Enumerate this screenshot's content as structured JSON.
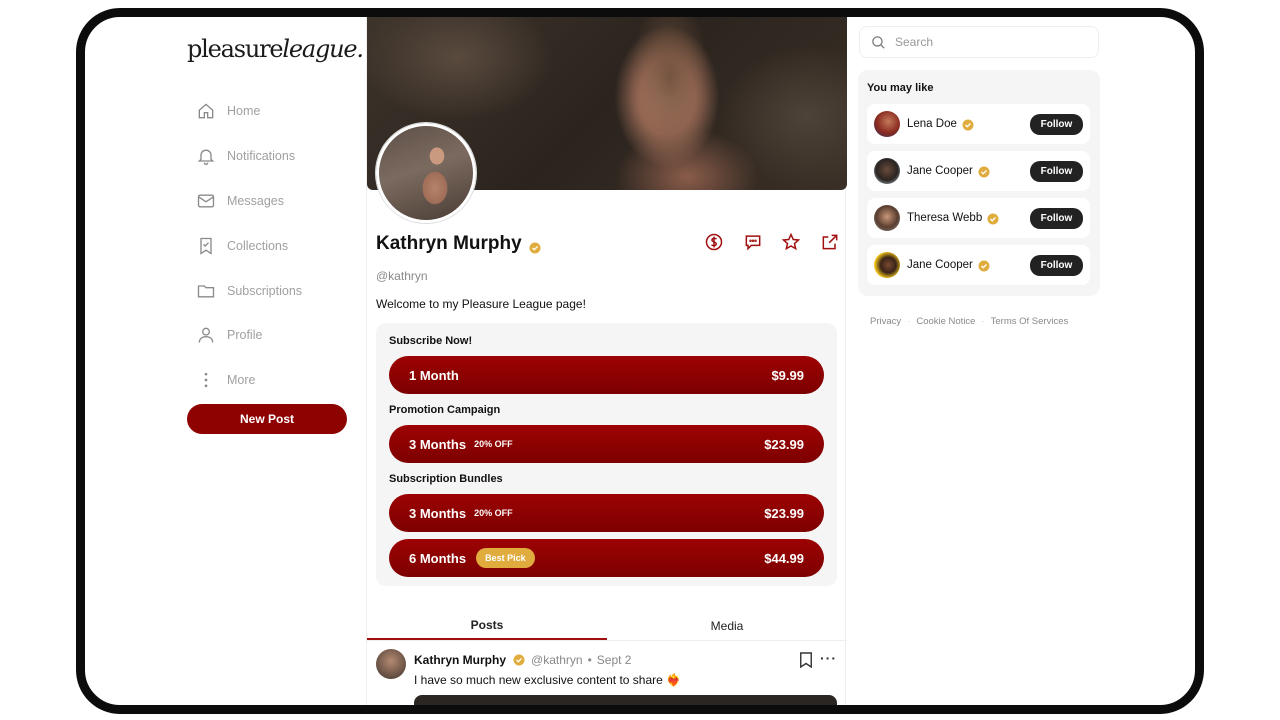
{
  "app": {
    "logo_regular": "pleasure",
    "logo_italic": "league."
  },
  "nav": {
    "items": [
      {
        "label": "Home",
        "icon": "home-icon"
      },
      {
        "label": "Notifications",
        "icon": "bell-icon"
      },
      {
        "label": "Messages",
        "icon": "mail-icon"
      },
      {
        "label": "Collections",
        "icon": "bookmark-check-icon"
      },
      {
        "label": "Subscriptions",
        "icon": "folder-icon"
      },
      {
        "label": "Profile",
        "icon": "user-icon"
      },
      {
        "label": "More",
        "icon": "more-vertical-icon"
      }
    ],
    "new_post_label": "New Post"
  },
  "profile": {
    "name": "Kathryn Murphy",
    "handle": "@kathryn",
    "bio": "Welcome to my Pleasure League page!"
  },
  "subscribe": {
    "now_title": "Subscribe Now!",
    "now": {
      "duration": "1 Month",
      "price": "$9.99"
    },
    "promo_title": "Promotion Campaign",
    "promo": {
      "duration": "3 Months",
      "discount": "20% OFF",
      "price": "$23.99"
    },
    "bundles_title": "Subscription Bundles",
    "bundles": [
      {
        "duration": "3 Months",
        "discount": "20% OFF",
        "price": "$23.99"
      },
      {
        "duration": "6 Months",
        "badge": "Best Pick",
        "price": "$44.99"
      }
    ]
  },
  "tabs": [
    {
      "label": "Posts",
      "active": true
    },
    {
      "label": "Media",
      "active": false
    }
  ],
  "post": {
    "author": "Kathryn Murphy",
    "handle": "@kathryn",
    "separator": "•",
    "date": "Sept 2",
    "text": "I have so much new exclusive content to share",
    "emoji": "❤️‍🔥"
  },
  "search": {
    "placeholder": "Search"
  },
  "suggestions": {
    "title": "You may like",
    "follow_label": "Follow",
    "people": [
      {
        "name": "Lena Doe"
      },
      {
        "name": "Jane Cooper"
      },
      {
        "name": "Theresa Webb"
      },
      {
        "name": "Jane Cooper"
      }
    ]
  },
  "footer": {
    "privacy": "Privacy",
    "cookie": "Cookie Notice",
    "terms": "Terms Of Services"
  },
  "colors": {
    "accent": "#8e0202",
    "verified": "#e0ac3e",
    "badge": "#e0ac3e",
    "follow_button": "#222222"
  }
}
